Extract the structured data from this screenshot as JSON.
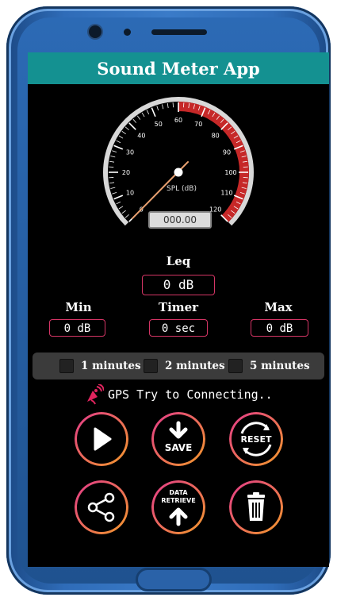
{
  "app": {
    "title": "Sound Meter App"
  },
  "gauge": {
    "value_db": 0,
    "readout": "000.00",
    "unit_label": "SPL (dB)",
    "min": 0,
    "max": 120,
    "red_zone_start": 60,
    "ticks": [
      "0",
      "10",
      "20",
      "30",
      "40",
      "50",
      "60",
      "70",
      "80",
      "90",
      "100",
      "110",
      "120"
    ]
  },
  "stats": {
    "leq_label": "Leq",
    "leq_value": "0 dB",
    "min_label": "Min",
    "min_value": "0 dB",
    "timer_label": "Timer",
    "timer_value": "0 sec",
    "max_label": "Max",
    "max_value": "0 dB"
  },
  "durations": [
    {
      "label": "1 minutes",
      "checked": false
    },
    {
      "label": "2 minutes",
      "checked": false
    },
    {
      "label": "5 minutes",
      "checked": false
    }
  ],
  "gps": {
    "status": "GPS Try to Connecting..",
    "icon": "satellite-icon"
  },
  "buttons": {
    "play": {
      "icon": "play-icon"
    },
    "save": {
      "label": "SAVE",
      "icon": "download-arrow-icon"
    },
    "reset": {
      "label": "RESET",
      "icon": "refresh-icon"
    },
    "share": {
      "icon": "share-icon"
    },
    "retrieve": {
      "label_line1": "DATA",
      "label_line2": "RETRIEVE",
      "icon": "upload-arrow-icon"
    },
    "delete": {
      "icon": "trash-icon"
    }
  },
  "colors": {
    "titlebar": "#149191",
    "accent_red": "#c62828",
    "box_border": "#d43565",
    "button_gradient_start": "#e33a8a",
    "button_gradient_end": "#f39a2a"
  }
}
